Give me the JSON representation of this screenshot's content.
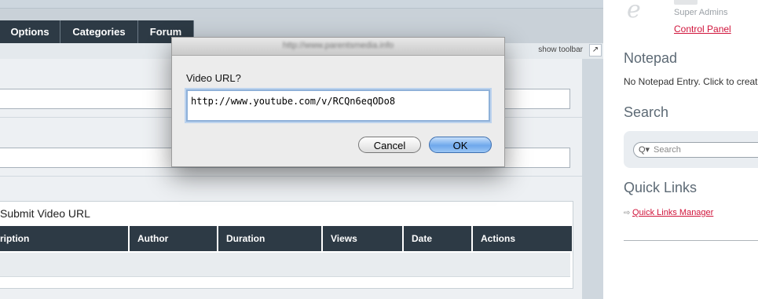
{
  "tabs": [
    {
      "label": "Options"
    },
    {
      "label": "Categories"
    },
    {
      "label": "Forum"
    }
  ],
  "toolbar": {
    "show_toolbar": "show toolbar",
    "toggle_icon": "expand-arrow-icon",
    "toggle_glyph": "↗"
  },
  "video_section": {
    "title": "Submit Video URL",
    "columns": [
      "ription",
      "Author",
      "Duration",
      "Views",
      "Date",
      "Actions"
    ]
  },
  "sidebar": {
    "logo_glyph": "e",
    "user_role": "Super Admins",
    "control_panel": "Control Panel",
    "notepad": {
      "title": "Notepad",
      "text": "No Notepad Entry. Click to creat"
    },
    "search": {
      "title": "Search",
      "placeholder": "Search",
      "icon_glyph": "Q▾"
    },
    "quick_links": {
      "title": "Quick Links",
      "arrow": "⇨",
      "manager": "Quick Links Manager"
    }
  },
  "dialog": {
    "url": "http://www.parentsmedia.info",
    "label": "Video URL?",
    "input_value": "http://www.youtube.com/v/RCQn6eqODo8",
    "cancel_label": "Cancel",
    "ok_label": "OK"
  },
  "colors": {
    "accent_link": "#d0143b",
    "tab_bg": "#2d3a45",
    "ok_button": "#6ea8ec"
  }
}
